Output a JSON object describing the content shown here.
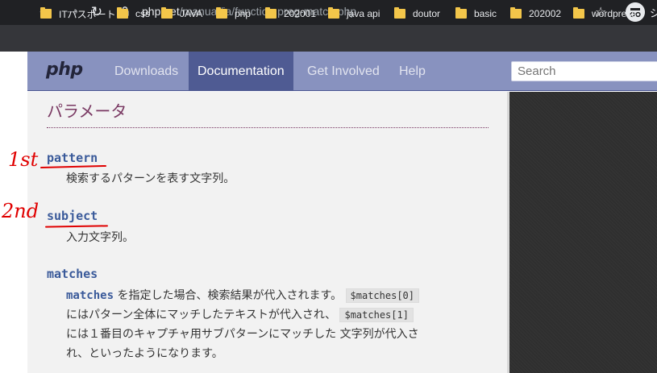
{
  "browser": {
    "url_host": "php.net",
    "url_path": "/manual/ja/function.preg-match.php",
    "profile_label": "シ"
  },
  "bookmarks": [
    "ITパスポート",
    "css",
    "JAVA",
    "php",
    "202001",
    "java api",
    "doutor",
    "basic",
    "202002",
    "wordpress"
  ],
  "php_nav": {
    "logo": "php",
    "items": [
      "Downloads",
      "Documentation",
      "Get Involved",
      "Help"
    ],
    "active": "Documentation",
    "search_placeholder": "Search"
  },
  "content": {
    "heading": "パラメータ",
    "params": [
      {
        "name": "pattern",
        "desc": "検索するパターンを表す文字列。"
      },
      {
        "name": "subject",
        "desc": "入力文字列。"
      },
      {
        "name": "matches",
        "desc_line1_term": "matches",
        "desc_line1": "を指定した場合、検索結果が代入されます。",
        "code1": "$matches[0]",
        "desc_line2": "にはパターン全体にマッチしたテキストが代入され、",
        "code2": "$matches[1]",
        "desc_line3": "には１番目のキャプチャ用サブパターンにマッチした 文字列が代入さ",
        "desc_line4": "れ、といったようになります。"
      }
    ]
  },
  "annotations": {
    "first": "1st",
    "second": "2nd"
  },
  "colors": {
    "php_nav": "#8892bf",
    "php_nav_active": "#4f5b93",
    "heading": "#793862",
    "term": "#3a5a9a",
    "annotation": "#e00000"
  }
}
